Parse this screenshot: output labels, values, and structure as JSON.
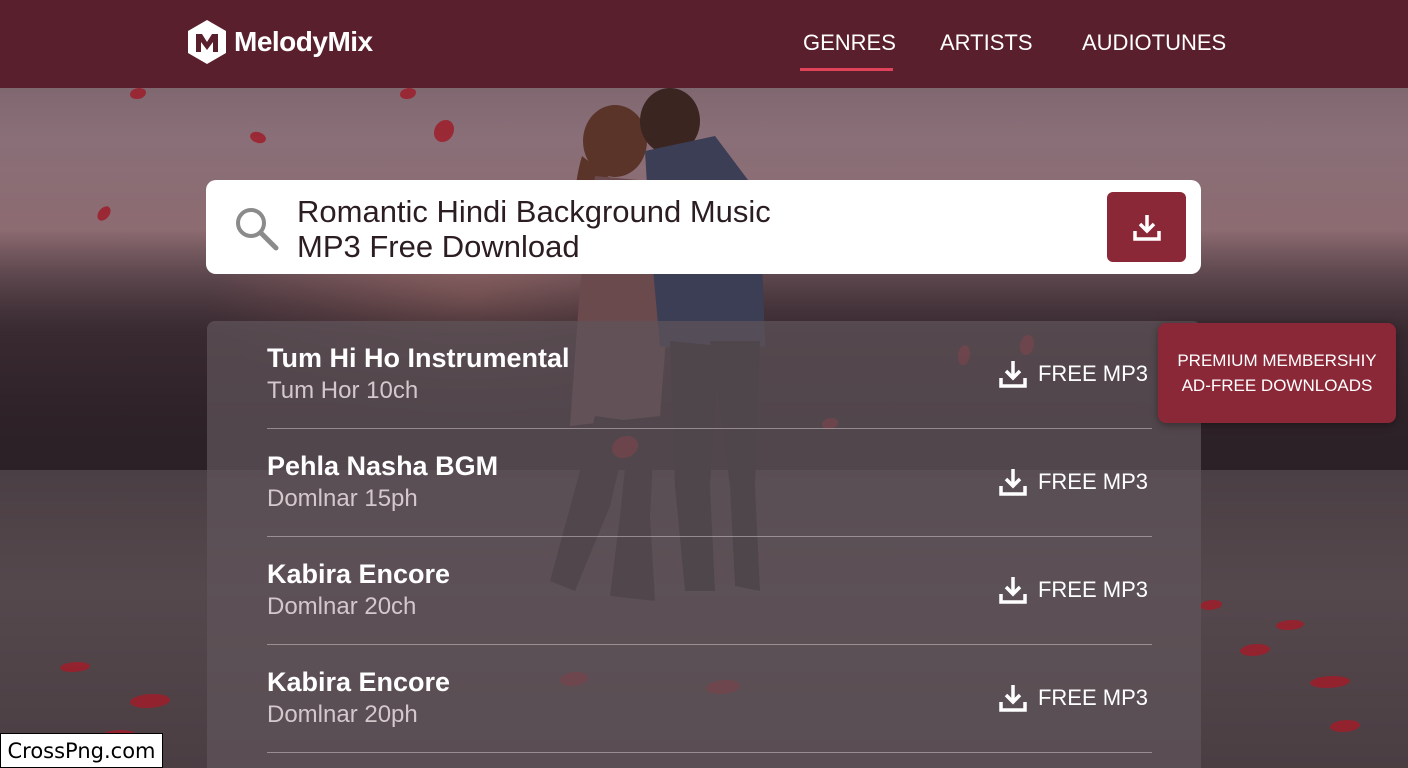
{
  "brand": {
    "name": "MelodyMix"
  },
  "nav": [
    {
      "label": "GENRES",
      "active": true
    },
    {
      "label": "ARTISTS",
      "active": false
    },
    {
      "label": "AUDIOTUNES",
      "active": false
    }
  ],
  "search": {
    "line1": "Romantic Hindi Background Music",
    "line2": "MP3 Free Download"
  },
  "tracks": [
    {
      "title": "Tum Hi Ho Instrumental",
      "subtitle": "Tum Hor 10ch",
      "action": "FREE MP3"
    },
    {
      "title": "Pehla Nasha BGM",
      "subtitle": "Domlnar 15ph",
      "action": "FREE MP3"
    },
    {
      "title": "Kabira Encore",
      "subtitle": "Domlnar 20ch",
      "action": "FREE MP3"
    },
    {
      "title": "Kabira Encore",
      "subtitle": "Domlnar 20ph",
      "action": "FREE MP3"
    }
  ],
  "premium": {
    "line1": "PREMIUM MEMBERSHIY",
    "line2": "AD-FREE DOWNLOADS"
  },
  "watermark": "CrossPng.com",
  "colors": {
    "header": "#5a1f2c",
    "accent": "#8a2838",
    "nav_underline": "#e0425a"
  },
  "icons": [
    "logo-icon",
    "search-icon",
    "download-icon"
  ]
}
